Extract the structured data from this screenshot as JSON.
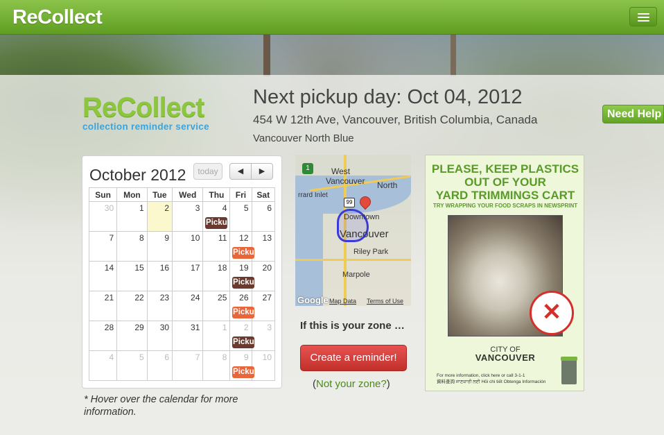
{
  "topbar": {
    "brand": "ReCollect",
    "menu_icon": "hamburger-icon"
  },
  "logo": {
    "word": "ReCollect",
    "tagline": "collection reminder service"
  },
  "header": {
    "next_pickup": "Next pickup day: Oct 04, 2012",
    "address": "454 W 12th Ave, Vancouver, British Columbia, Canada",
    "zone": "Vancouver North Blue"
  },
  "need_help": "Need Help",
  "calendar": {
    "title": "October 2012",
    "today_label": "today",
    "prev_label": "◀",
    "next_label": "▶",
    "weekdays": [
      "Sun",
      "Mon",
      "Tue",
      "Wed",
      "Thu",
      "Fri",
      "Sat"
    ],
    "weeks": [
      [
        {
          "d": "30",
          "other": true
        },
        {
          "d": "1"
        },
        {
          "d": "2",
          "today": true
        },
        {
          "d": "3"
        },
        {
          "d": "4",
          "event": "Picku",
          "color": "brown"
        },
        {
          "d": "5"
        },
        {
          "d": "6"
        }
      ],
      [
        {
          "d": "7"
        },
        {
          "d": "8"
        },
        {
          "d": "9"
        },
        {
          "d": "10"
        },
        {
          "d": "11"
        },
        {
          "d": "12",
          "event": "Picku",
          "color": "orange"
        },
        {
          "d": "13"
        }
      ],
      [
        {
          "d": "14"
        },
        {
          "d": "15"
        },
        {
          "d": "16"
        },
        {
          "d": "17"
        },
        {
          "d": "18"
        },
        {
          "d": "19",
          "event": "Picku",
          "color": "brown"
        },
        {
          "d": "20"
        }
      ],
      [
        {
          "d": "21"
        },
        {
          "d": "22"
        },
        {
          "d": "23"
        },
        {
          "d": "24"
        },
        {
          "d": "25"
        },
        {
          "d": "26",
          "event": "Picku",
          "color": "orange"
        },
        {
          "d": "27"
        }
      ],
      [
        {
          "d": "28"
        },
        {
          "d": "29"
        },
        {
          "d": "30"
        },
        {
          "d": "31"
        },
        {
          "d": "1",
          "other": true
        },
        {
          "d": "2",
          "other": true,
          "event": "Picku",
          "color": "brown"
        },
        {
          "d": "3",
          "other": true
        }
      ],
      [
        {
          "d": "4",
          "other": true
        },
        {
          "d": "5",
          "other": true
        },
        {
          "d": "6",
          "other": true
        },
        {
          "d": "7",
          "other": true
        },
        {
          "d": "8",
          "other": true
        },
        {
          "d": "9",
          "other": true,
          "event": "Picku",
          "color": "orange"
        },
        {
          "d": "10",
          "other": true
        }
      ]
    ],
    "event_colors": {
      "brown": "#6b3a2e",
      "orange": "#e8663a"
    },
    "hover_note": "* Hover over the calendar for more information."
  },
  "map": {
    "labels": {
      "west_vancouver": "West\nVancouver",
      "north": "North",
      "vancouver": "Vancouver",
      "downtown": "Downtown",
      "inlet": "rrard Inlet",
      "riley_park": "Riley Park",
      "marpole": "Marpole",
      "highway": "99"
    },
    "google": "Google",
    "map_data": "Map Data",
    "terms": "Terms of Use"
  },
  "zone_question": "If this is your zone …",
  "create_reminder": "Create a reminder!",
  "not_zone": {
    "open": "(",
    "link": "Not your zone?",
    "close": ")"
  },
  "poster": {
    "headline_1": "PLEASE, KEEP PLASTICS",
    "headline_2": "OUT OF YOUR",
    "headline_3": "YARD TRIMMINGS CART",
    "sub": "TRY WRAPPING YOUR FOOD SCRAPS IN NEWSPRINT",
    "city_small": "CITY OF",
    "city_big": "VANCOUVER",
    "footer_1": "For more information, click here or call 3-1-1",
    "footer_2": "資料查詢  ਜਾਣਕਾਰੀ ਲਈ  Hỏi chi tiết  Obtenga Información"
  }
}
